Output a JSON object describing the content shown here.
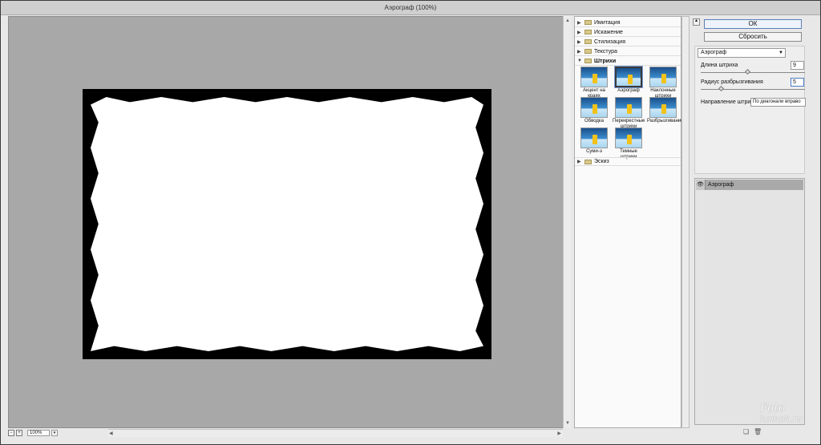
{
  "window": {
    "title": "Аэрограф (100%)"
  },
  "preview": {
    "zoom_value": "100%",
    "zoom_out_label": "−",
    "zoom_in_label": "+",
    "dropdown_glyph": "▾"
  },
  "filter_folders": [
    {
      "label": "Имитация",
      "expanded": false
    },
    {
      "label": "Искажение",
      "expanded": false
    },
    {
      "label": "Стилизация",
      "expanded": false
    },
    {
      "label": "Текстура",
      "expanded": false
    },
    {
      "label": "Штрихи",
      "expanded": true
    },
    {
      "label": "Эскиз",
      "expanded": false
    }
  ],
  "stroke_filters": [
    {
      "label": "Акцент на краях"
    },
    {
      "label": "Аэрограф",
      "selected": true
    },
    {
      "label": "Наклонные штрихи"
    },
    {
      "label": "Обводка"
    },
    {
      "label": "Перекрестные штрихи"
    },
    {
      "label": "Разбрызгивание"
    },
    {
      "label": "Суми-э"
    },
    {
      "label": "Темные штрихи"
    }
  ],
  "buttons": {
    "ok": "ОК",
    "reset": "Сбросить"
  },
  "params": {
    "filter_select": "Аэрограф",
    "stroke_length_label": "Длина штриха",
    "stroke_length_value": "9",
    "stroke_length_fraction": 0.45,
    "spray_radius_label": "Радиус разбрызгивания",
    "spray_radius_value": "5",
    "spray_radius_fraction": 0.2,
    "direction_label": "Направление штрихов:",
    "direction_value": "По диагонали вправо"
  },
  "layers": [
    {
      "name": "Аэрограф",
      "visible": true
    }
  ],
  "watermark": {
    "line1": "Foto",
    "line2": "komok.ru"
  },
  "colors": {
    "canvas_bg": "#a8a8a8",
    "selected_layer": "#a9a9a9"
  }
}
